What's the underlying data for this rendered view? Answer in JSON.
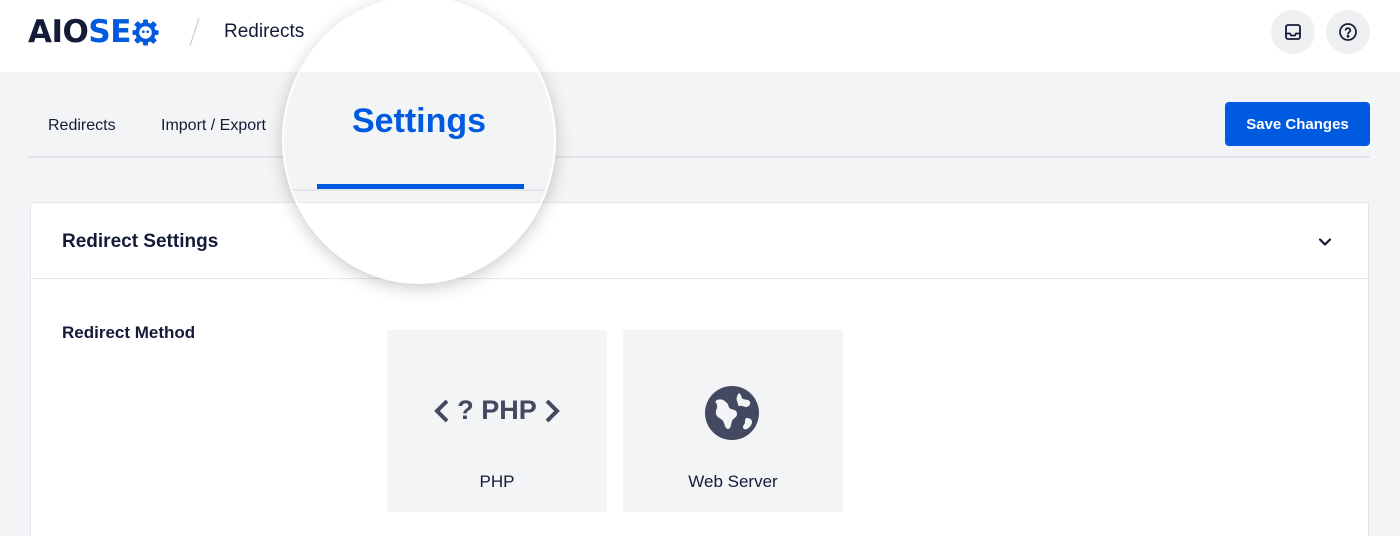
{
  "header": {
    "logo": {
      "part1": "AIO",
      "part2": "SE",
      "brand_blue": "#005ae0",
      "brand_dark": "#141b38"
    },
    "breadcrumb": "Redirects",
    "icons": [
      "inbox-icon",
      "help-icon"
    ]
  },
  "tabs": [
    {
      "label": "Redirects",
      "active": false
    },
    {
      "label": "Import / Export",
      "active": false
    },
    {
      "label": "Settings",
      "active": true
    }
  ],
  "save_button": "Save Changes",
  "card": {
    "title": "Redirect Settings",
    "row_label": "Redirect Method",
    "options": [
      {
        "label": "PHP",
        "icon": "php-icon",
        "icon_text": "<?PHP>"
      },
      {
        "label": "Web Server",
        "icon": "globe-icon"
      }
    ]
  },
  "colors": {
    "accent": "#005ae0",
    "page_bg": "#f3f4f5",
    "text": "#141b38"
  }
}
